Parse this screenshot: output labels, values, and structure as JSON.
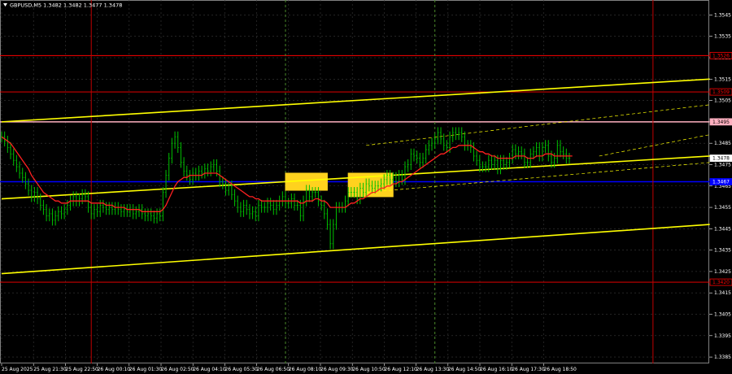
{
  "header": {
    "symbol_info": "GBPUSD,M5  1.3482 1.3482 1.3477 1.3478",
    "menu_icon": "triangle-down-icon"
  },
  "colors": {
    "background": "#000000",
    "grid": "#3a3a3a",
    "candle": "#00c000",
    "ma": "#ff2020",
    "support_resistance": "#ff0000",
    "level_pink": "#ffb0c0",
    "blue_level": "#0000ff",
    "channel": "#ffff00",
    "signal_box": "#ffd21e",
    "vertical_green": "#4a8a2a",
    "vertical_red": "#c00000",
    "axis_text": "#ffffff"
  },
  "chart_data": {
    "type": "candlestick",
    "instrument": "GBPUSD",
    "timeframe": "M5",
    "ohlc_last": {
      "open": 1.3482,
      "high": 1.3482,
      "low": 1.3477,
      "close": 1.3478
    },
    "ylim": [
      1.3382,
      1.3552
    ],
    "y_ticks": [
      "1.3545",
      "1.3535",
      "1.3525",
      "1.3515",
      "1.3505",
      "1.3495",
      "1.3485",
      "1.3475",
      "1.3465",
      "1.3455",
      "1.3445",
      "1.3435",
      "1.3425",
      "1.3415",
      "1.3405",
      "1.3395",
      "1.3385"
    ],
    "x_ticks": [
      "25 Aug 2025",
      "25 Aug 21:30",
      "25 Aug 22:50",
      "26 Aug 00:10",
      "26 Aug 01:30",
      "26 Aug 02:50",
      "26 Aug 04:10",
      "26 Aug 05:30",
      "26 Aug 06:50",
      "26 Aug 08:10",
      "26 Aug 09:30",
      "26 Aug 10:50",
      "26 Aug 12:10",
      "26 Aug 13:30",
      "26 Aug 14:50",
      "26 Aug 16:10",
      "26 Aug 17:30",
      "26 Aug 18:50"
    ],
    "price_tags": [
      {
        "label": "1.3526",
        "value": 1.3526,
        "color": "#ff0000",
        "text_color": "#ff0000"
      },
      {
        "label": "1.3509",
        "value": 1.3509,
        "color": "#ff0000",
        "text_color": "#ff0000"
      },
      {
        "label": "1.3495",
        "value": 1.3495,
        "color": "#ffb0c0",
        "text_color": "#000000"
      },
      {
        "label": "1.3478",
        "value": 1.3478,
        "color": "#ffffff",
        "text_color": "#000000"
      },
      {
        "label": "1.3467",
        "value": 1.3467,
        "color": "#0000ff",
        "text_color": "#ffffff"
      },
      {
        "label": "1.3420",
        "value": 1.342,
        "color": "#ff0000",
        "text_color": "#ff0000"
      }
    ],
    "horizontal_lines": [
      {
        "value": 1.3526,
        "color": "#ff0000",
        "style": "solid"
      },
      {
        "value": 1.3509,
        "color": "#ff0000",
        "style": "solid"
      },
      {
        "value": 1.3495,
        "color": "#ffb0c0",
        "style": "solid"
      },
      {
        "value": 1.3467,
        "color": "#0000ff",
        "style": "solid"
      },
      {
        "value": 1.342,
        "color": "#ff0000",
        "style": "solid"
      }
    ],
    "vertical_lines": [
      {
        "index": 30,
        "color": "#c00000",
        "style": "solid"
      },
      {
        "index": 95,
        "color": "#4a8a2a",
        "style": "dashed"
      },
      {
        "index": 145,
        "color": "#4a8a2a",
        "style": "dashed"
      },
      {
        "index": 218,
        "color": "#c00000",
        "style": "solid"
      }
    ],
    "channel_lines": [
      {
        "from": [
          0,
          1.3459
        ],
        "to": [
          237,
          1.3479
        ],
        "style": "solid"
      },
      {
        "from": [
          0,
          1.3424
        ],
        "to": [
          237,
          1.3447
        ],
        "style": "solid"
      },
      {
        "from": [
          0,
          1.3495
        ],
        "to": [
          237,
          1.3515
        ],
        "style": "solid"
      },
      {
        "from": [
          122,
          1.3484
        ],
        "to": [
          237,
          1.3503
        ],
        "style": "dashed"
      },
      {
        "from": [
          122,
          1.3462
        ],
        "to": [
          237,
          1.3476
        ],
        "style": "dashed"
      },
      {
        "from": [
          200,
          1.3479
        ],
        "to": [
          237,
          1.3489
        ],
        "style": "dashed"
      }
    ],
    "signal_boxes": [
      {
        "x_from": 95,
        "x_to": 109,
        "y_low": 1.3463,
        "y_high": 1.3471
      },
      {
        "x_from": 116,
        "x_to": 131,
        "y_low": 1.346,
        "y_high": 1.3471
      }
    ],
    "close": [
      1.3488,
      1.3486,
      1.3483,
      1.348,
      1.3477,
      1.3474,
      1.3471,
      1.3469,
      1.3466,
      1.3463,
      1.346,
      1.3462,
      1.3459,
      1.3456,
      1.3454,
      1.3451,
      1.3452,
      1.3449,
      1.3451,
      1.3453,
      1.3452,
      1.3454,
      1.3456,
      1.3458,
      1.346,
      1.3458,
      1.3459,
      1.3461,
      1.346,
      1.3455,
      1.3452,
      1.3454,
      1.3453,
      1.3456,
      1.3455,
      1.3454,
      1.3455,
      1.3454,
      1.3455,
      1.3454,
      1.3453,
      1.3454,
      1.3453,
      1.3454,
      1.3452,
      1.3453,
      1.3454,
      1.3452,
      1.3451,
      1.3452,
      1.3451,
      1.345,
      1.3452,
      1.3451,
      1.3462,
      1.347,
      1.3478,
      1.3485,
      1.3488,
      1.3483,
      1.3476,
      1.3472,
      1.347,
      1.3468,
      1.3471,
      1.347,
      1.3472,
      1.3471,
      1.3473,
      1.3472,
      1.3474,
      1.3475,
      1.3472,
      1.3467,
      1.3466,
      1.3463,
      1.3465,
      1.3461,
      1.3458,
      1.3455,
      1.3453,
      1.3456,
      1.3454,
      1.3452,
      1.3453,
      1.3451,
      1.3456,
      1.3455,
      1.3455,
      1.3457,
      1.3456,
      1.3454,
      1.3456,
      1.3458,
      1.346,
      1.3457,
      1.3457,
      1.3459,
      1.3456,
      1.3456,
      1.3451,
      1.3458,
      1.3463,
      1.346,
      1.3462,
      1.3462,
      1.3458,
      1.3456,
      1.3452,
      1.3447,
      1.3438,
      1.3447,
      1.3455,
      1.3455,
      1.3455,
      1.3458,
      1.3462,
      1.3462,
      1.3462,
      1.3459,
      1.3464,
      1.3462,
      1.3466,
      1.3465,
      1.3464,
      1.3465,
      1.3465,
      1.3466,
      1.3468,
      1.347,
      1.3468,
      1.3469,
      1.3467,
      1.347,
      1.3468,
      1.3474,
      1.3475,
      1.348,
      1.3479,
      1.3478,
      1.3476,
      1.3478,
      1.3482,
      1.3484,
      1.3485,
      1.3487,
      1.349,
      1.3487,
      1.3484,
      1.3483,
      1.3488,
      1.349,
      1.3489,
      1.349,
      1.3488,
      1.3484,
      1.3484,
      1.3483,
      1.3479,
      1.3477,
      1.3474,
      1.3474,
      1.3474,
      1.3477,
      1.3475,
      1.3477,
      1.3473,
      1.3477,
      1.3475,
      1.3476,
      1.3478,
      1.3482,
      1.348,
      1.3481,
      1.348,
      1.3476,
      1.3476,
      1.348,
      1.3481,
      1.3483,
      1.3479,
      1.3483,
      1.3484,
      1.3479,
      1.3476,
      1.3478,
      1.3484,
      1.3481,
      1.348,
      1.3478,
      1.3478
    ],
    "ma": [
      1.3488,
      1.3487,
      1.3486,
      1.3485,
      1.3483,
      1.3481,
      1.3479,
      1.3477,
      1.3475,
      1.3473,
      1.347,
      1.3468,
      1.3466,
      1.3464,
      1.3462,
      1.3461,
      1.346,
      1.3459,
      1.3458,
      1.3458,
      1.3457,
      1.3457,
      1.3457,
      1.3458,
      1.3458,
      1.3458,
      1.3458,
      1.3458,
      1.3458,
      1.3458,
      1.3457,
      1.3457,
      1.3457,
      1.3457,
      1.3457,
      1.3456,
      1.3456,
      1.3456,
      1.3455,
      1.3455,
      1.3455,
      1.3455,
      1.3454,
      1.3454,
      1.3454,
      1.3454,
      1.3454,
      1.3453,
      1.3453,
      1.3453,
      1.3453,
      1.3453,
      1.3453,
      1.3453,
      1.3454,
      1.3456,
      1.3459,
      1.3462,
      1.3465,
      1.3467,
      1.3468,
      1.3469,
      1.3469,
      1.347,
      1.347,
      1.347,
      1.347,
      1.347,
      1.3471,
      1.3471,
      1.3471,
      1.3471,
      1.3471,
      1.347,
      1.3469,
      1.3468,
      1.3467,
      1.3466,
      1.3465,
      1.3464,
      1.3463,
      1.3462,
      1.3461,
      1.346,
      1.346,
      1.3459,
      1.3459,
      1.3458,
      1.3458,
      1.3458,
      1.3458,
      1.3458,
      1.3458,
      1.3458,
      1.3458,
      1.3458,
      1.3458,
      1.3458,
      1.3458,
      1.3458,
      1.3457,
      1.3457,
      1.3458,
      1.3458,
      1.3458,
      1.3459,
      1.3459,
      1.3458,
      1.3458,
      1.3457,
      1.3455,
      1.3455,
      1.3455,
      1.3455,
      1.3455,
      1.3455,
      1.3456,
      1.3457,
      1.3457,
      1.3458,
      1.3459,
      1.3459,
      1.346,
      1.3461,
      1.3462,
      1.3462,
      1.3463,
      1.3464,
      1.3464,
      1.3465,
      1.3465,
      1.3466,
      1.3466,
      1.3467,
      1.3467,
      1.3468,
      1.3469,
      1.347,
      1.3471,
      1.3472,
      1.3473,
      1.3474,
      1.3475,
      1.3476,
      1.3477,
      1.3478,
      1.3479,
      1.348,
      1.348,
      1.3481,
      1.3482,
      1.3483,
      1.3483,
      1.3484,
      1.3484,
      1.3484,
      1.3484,
      1.3484,
      1.3483,
      1.3482,
      1.3481,
      1.3481,
      1.348,
      1.348,
      1.3479,
      1.3479,
      1.3478,
      1.3478,
      1.3478,
      1.3478,
      1.3478,
      1.3478,
      1.3479,
      1.3479,
      1.3479,
      1.3479,
      1.3478,
      1.3478,
      1.3478,
      1.3479,
      1.3479,
      1.3479,
      1.348,
      1.348,
      1.348,
      1.3479,
      1.3479,
      1.3479,
      1.3479,
      1.3479,
      1.3479,
      1.3479
    ]
  }
}
